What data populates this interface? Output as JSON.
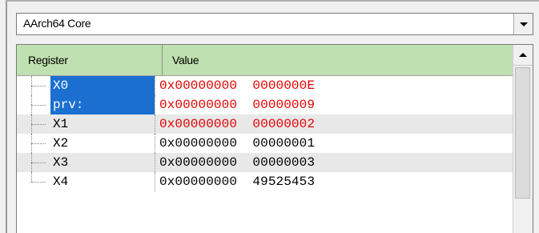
{
  "core_select": {
    "value": "AArch64 Core"
  },
  "table": {
    "col_register": "Register",
    "col_value": "Value",
    "rows": [
      {
        "name": "X0",
        "value": "0x00000000  0000000E",
        "selected": true,
        "changed": true
      },
      {
        "name": "prv:",
        "value": "0x00000000  00000009",
        "selected": true,
        "changed": true
      },
      {
        "name": "X1",
        "value": "0x00000000  00000002",
        "selected": false,
        "changed": true
      },
      {
        "name": "X2",
        "value": "0x00000000  00000001",
        "selected": false,
        "changed": false
      },
      {
        "name": "X3",
        "value": "0x00000000  00000003",
        "selected": false,
        "changed": false
      },
      {
        "name": "X4",
        "value": "0x00000000  49525453",
        "selected": false,
        "changed": false
      }
    ]
  },
  "colors": {
    "header_bg": "#bfe0b0",
    "selection": "#1a6fd0",
    "changed_value": "#e00000"
  },
  "icons": {
    "dropdown": "chevron-down-icon",
    "scroll_up": "scroll-up-arrow-icon"
  }
}
